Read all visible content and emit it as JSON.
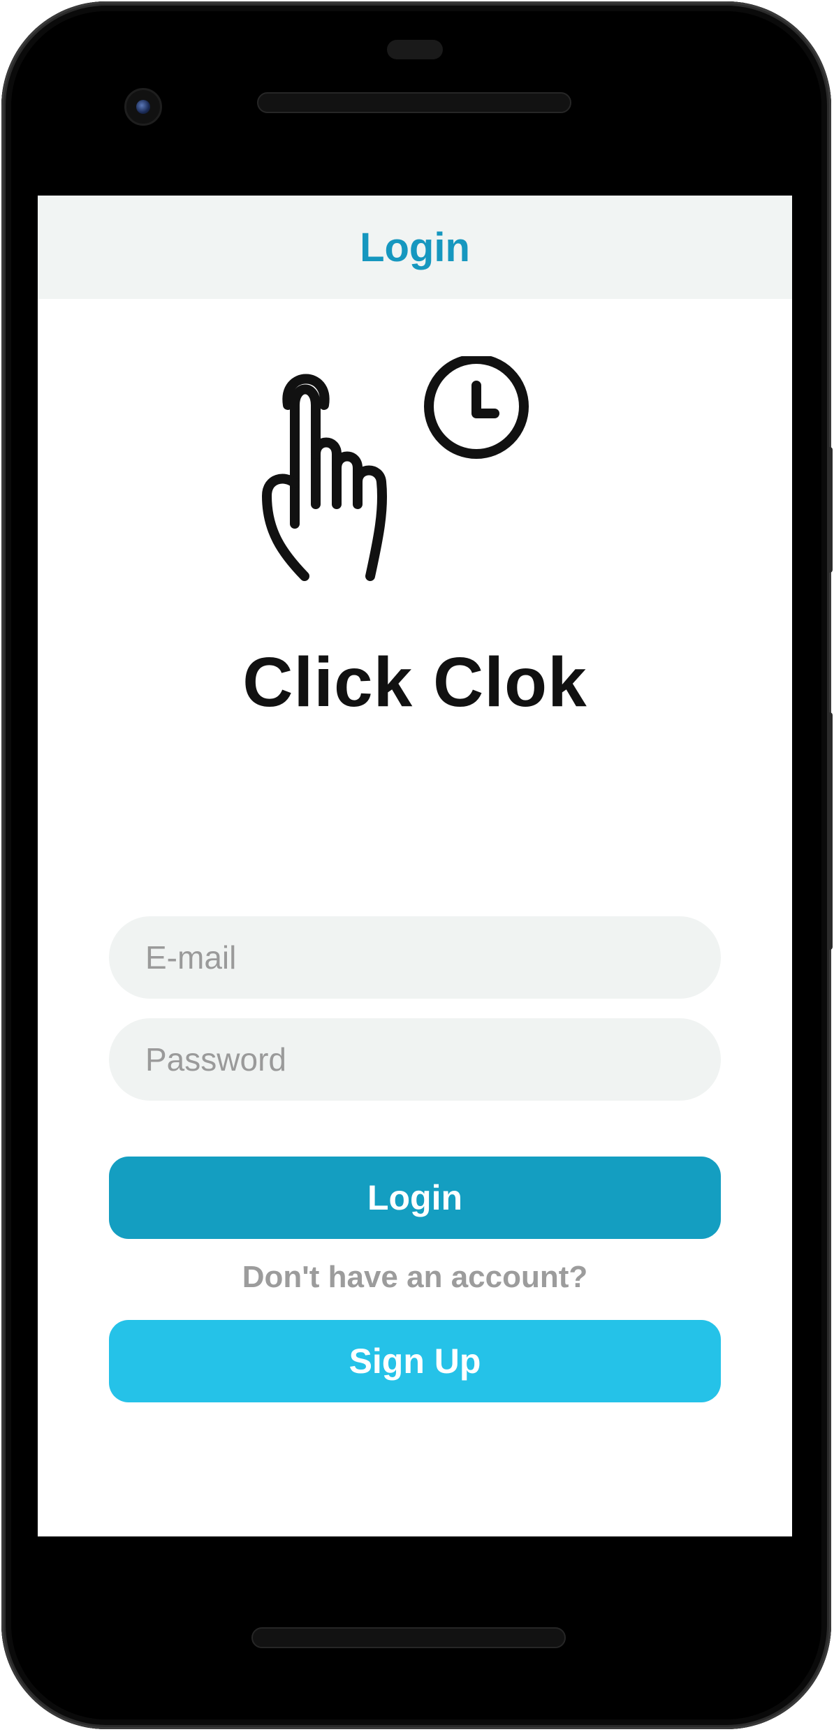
{
  "appbar": {
    "title": "Login"
  },
  "brand": {
    "name": "Click Clok",
    "logo_icon": "tap-finger-clock-icon"
  },
  "form": {
    "email_placeholder": "E-mail",
    "email_value": "",
    "password_placeholder": "Password",
    "password_value": ""
  },
  "actions": {
    "login_label": "Login",
    "signup_prompt": "Don't have an account?",
    "signup_label": "Sign Up"
  },
  "colors": {
    "accent": "#149ec1",
    "accent_light": "#25c2e8",
    "appbar_bg": "#f1f4f3",
    "field_bg": "#f0f3f2",
    "hint_text": "#9c9c9c"
  }
}
